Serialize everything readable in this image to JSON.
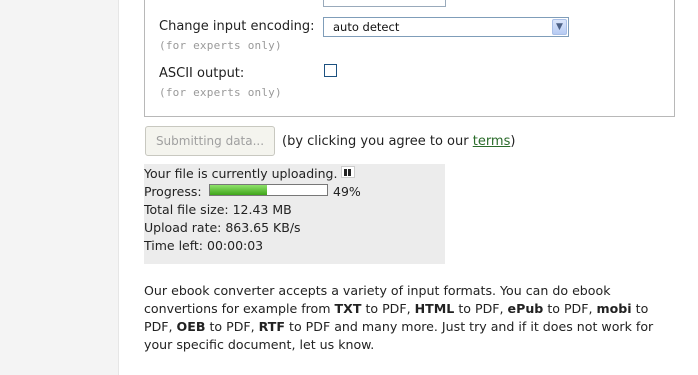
{
  "options": {
    "encoding": {
      "label": "Change input encoding:",
      "hint": "(for experts only)",
      "selected": "auto detect"
    },
    "ascii": {
      "label": "ASCII output:",
      "hint": "(for experts only)",
      "checked": false
    }
  },
  "submit": {
    "button_label": "Submitting data...",
    "agree_prefix": "(by clicking you agree to our ",
    "terms_link": "terms",
    "agree_suffix": ")"
  },
  "upload": {
    "status": "Your file is currently uploading.",
    "progress_label": "Progress:",
    "progress_value": 49,
    "progress_text": "49%",
    "total_size": "Total file size: 12.43 MB",
    "upload_rate": "Upload rate: 863.65 KB/s",
    "time_left": "Time left: 00:00:03"
  },
  "description": {
    "intro": "Our ebook converter accepts a variety of input formats. You can do ebook convertions for example from ",
    "fmt1": "TXT",
    "t1": " to PDF, ",
    "fmt2": "HTML",
    "t2": " to PDF, ",
    "fmt3": "ePub",
    "t3": " to PDF, ",
    "fmt4": "mobi",
    "t4": " to PDF, ",
    "fmt5": "OEB",
    "t5": " to PDF, ",
    "fmt6": "RTF",
    "t6": " to PDF and many more. Just try and if it does not work for your specific document, let us know."
  },
  "icons": {
    "select_arrow": "chevron-down-icon",
    "upload_pause": "pause-icon"
  }
}
